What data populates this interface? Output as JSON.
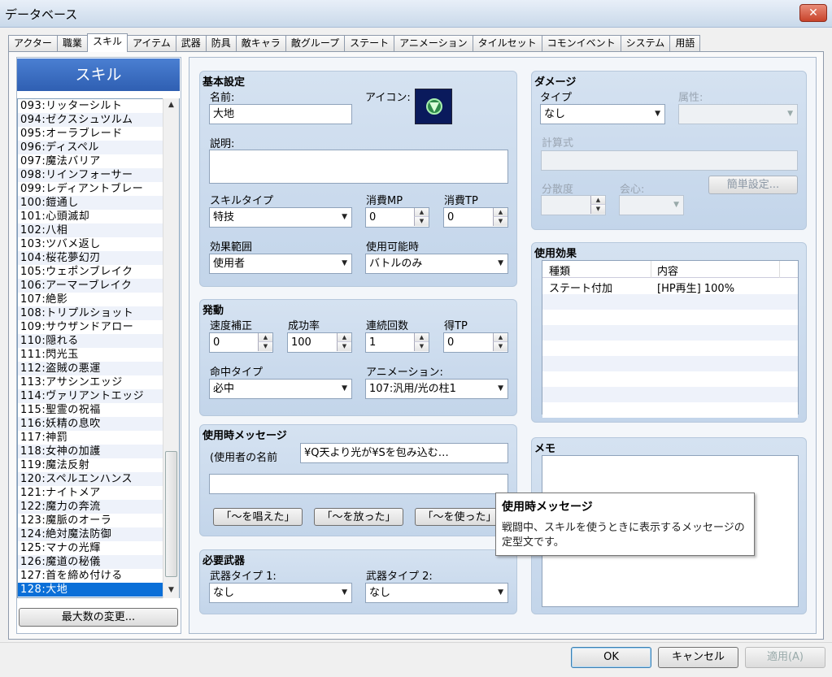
{
  "window": {
    "title": "データベース",
    "close_glyph": "✕"
  },
  "tabs": [
    {
      "label": "アクター"
    },
    {
      "label": "職業"
    },
    {
      "label": "スキル"
    },
    {
      "label": "アイテム"
    },
    {
      "label": "武器"
    },
    {
      "label": "防具"
    },
    {
      "label": "敵キャラ"
    },
    {
      "label": "敵グループ"
    },
    {
      "label": "ステート"
    },
    {
      "label": "アニメーション"
    },
    {
      "label": "タイルセット"
    },
    {
      "label": "コモンイベント"
    },
    {
      "label": "システム"
    },
    {
      "label": "用語"
    }
  ],
  "active_tab": "スキル",
  "sidebar": {
    "header": "スキル",
    "items": [
      "093:リッターシルト",
      "094:ゼクスシュツルム",
      "095:オーラブレード",
      "096:ディスペル",
      "097:魔法バリア",
      "098:リインフォーサー",
      "099:レディアントブレー",
      "100:鎧通し",
      "101:心頭滅却",
      "102:八相",
      "103:ツバメ返し",
      "104:桜花夢幻刃",
      "105:ウェポンブレイク",
      "106:アーマーブレイク",
      "107:絶影",
      "108:トリプルショット",
      "109:サウザンドアロー",
      "110:隠れる",
      "111:閃光玉",
      "112:盗賊の悪運",
      "113:アサシンエッジ",
      "114:ヴァリアントエッジ",
      "115:聖霊の祝福",
      "116:妖精の息吹",
      "117:神罰",
      "118:女神の加護",
      "119:魔法反射",
      "120:スペルエンハンス",
      "121:ナイトメア",
      "122:魔力の奔流",
      "123:魔脈のオーラ",
      "124:絶対魔法防御",
      "125:マナの光輝",
      "126:魔道の秘儀",
      "127:首を締め付ける",
      "128:大地"
    ],
    "selected_index": 35,
    "max_button": "最大数の変更..."
  },
  "basic": {
    "title": "基本設定",
    "name_label": "名前:",
    "name_value": "大地",
    "icon_label": "アイコン:",
    "desc_label": "説明:",
    "desc_value": "",
    "skilltype_label": "スキルタイプ",
    "skilltype_value": "特技",
    "mp_label": "消費MP",
    "mp_value": "0",
    "tp_label": "消費TP",
    "tp_value": "0",
    "scope_label": "効果範囲",
    "scope_value": "使用者",
    "occasion_label": "使用可能時",
    "occasion_value": "バトルのみ"
  },
  "invocation": {
    "title": "発動",
    "speed_label": "速度補正",
    "speed_value": "0",
    "success_label": "成功率",
    "success_value": "100",
    "repeats_label": "連続回数",
    "repeats_value": "1",
    "tpgain_label": "得TP",
    "tpgain_value": "0",
    "hittype_label": "命中タイプ",
    "hittype_value": "必中",
    "anim_label": "アニメーション:",
    "anim_value": "107:汎用/光の柱1"
  },
  "message": {
    "title": "使用時メッセージ",
    "prefix": "(使用者の名前",
    "line1": "¥Q天より光が¥Sを包み込む…",
    "line2": "",
    "btn1": "「〜を唱えた」",
    "btn2": "「〜を放った」",
    "btn3": "「〜を使った」"
  },
  "weapons": {
    "title": "必要武器",
    "w1_label": "武器タイプ 1:",
    "w1_value": "なし",
    "w2_label": "武器タイプ 2:",
    "w2_value": "なし"
  },
  "damage": {
    "title": "ダメージ",
    "type_label": "タイプ",
    "type_value": "なし",
    "element_label": "属性:",
    "element_value": "",
    "formula_label": "計算式",
    "formula_value": "",
    "variance_label": "分散度",
    "variance_value": "",
    "critical_label": "会心:",
    "critical_value": "",
    "quick_button": "簡単設定..."
  },
  "effects": {
    "title": "使用効果",
    "col_type": "種類",
    "col_content": "内容",
    "rows": [
      {
        "type": "ステート付加",
        "content": "[HP再生] 100%"
      }
    ]
  },
  "memo": {
    "title": "メモ",
    "value": ""
  },
  "tooltip": {
    "title": "使用時メッセージ",
    "body": "戦闘中、スキルを使うときに表示するメッセージの定型文です。"
  },
  "dialog": {
    "ok": "OK",
    "cancel": "キャンセル",
    "apply": "適用(A)"
  }
}
